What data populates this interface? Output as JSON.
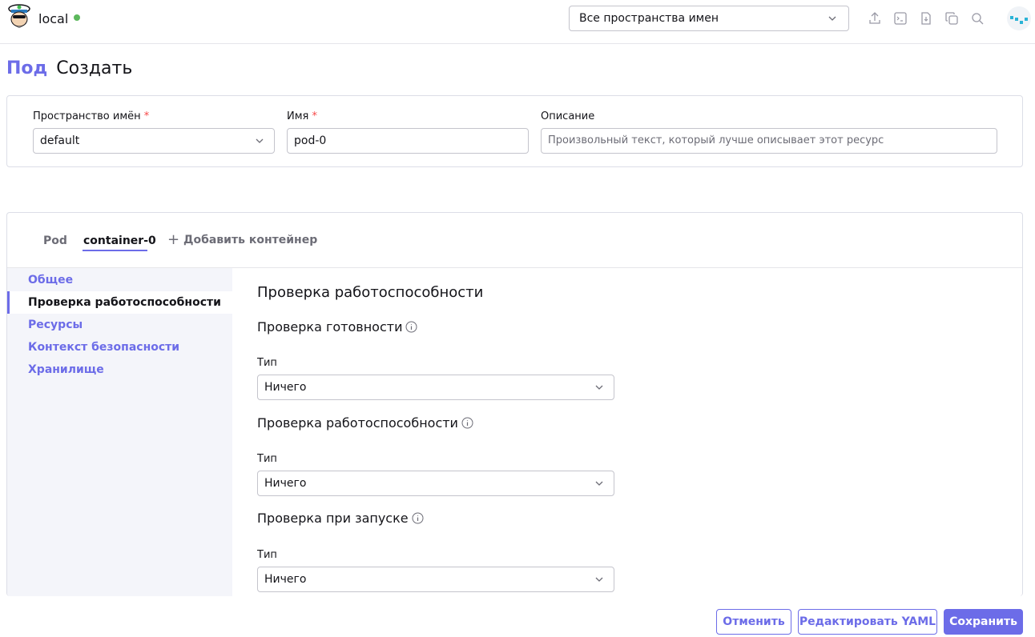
{
  "header": {
    "cluster_name": "local",
    "namespace_select": "Все пространства имен",
    "icons": [
      "upload-icon",
      "terminal-icon",
      "download-icon",
      "copy-icon",
      "search-icon"
    ]
  },
  "page": {
    "type": "Под",
    "action": "Создать"
  },
  "top_form": {
    "namespace_label": "Пространство имён",
    "namespace_value": "default",
    "name_label": "Имя",
    "name_value": "pod-0",
    "description_label": "Описание",
    "description_placeholder": "Произвольный текст, который лучше описывает этот ресурс",
    "required_mark": "*"
  },
  "tabs": {
    "pod": "Pod",
    "container": "container-0",
    "add": "Добавить контейнер"
  },
  "side_nav": [
    "Общее",
    "Проверка работоспособности",
    "Ресурсы",
    "Контекст безопасности",
    "Хранилище"
  ],
  "content": {
    "section_title": "Проверка работоспособности",
    "probes": [
      {
        "title": "Проверка готовности",
        "type_label": "Тип",
        "type_value": "Ничего"
      },
      {
        "title": "Проверка работоспособности",
        "type_label": "Тип",
        "type_value": "Ничего"
      },
      {
        "title": "Проверка при запуске",
        "type_label": "Тип",
        "type_value": "Ничего"
      }
    ]
  },
  "footer": {
    "cancel": "Отменить",
    "edit_yaml": "Редактировать YAML",
    "save": "Сохранить"
  },
  "colors": {
    "accent": "#6c6ce8",
    "status_active": "#5cb85c",
    "required": "#f64747"
  }
}
